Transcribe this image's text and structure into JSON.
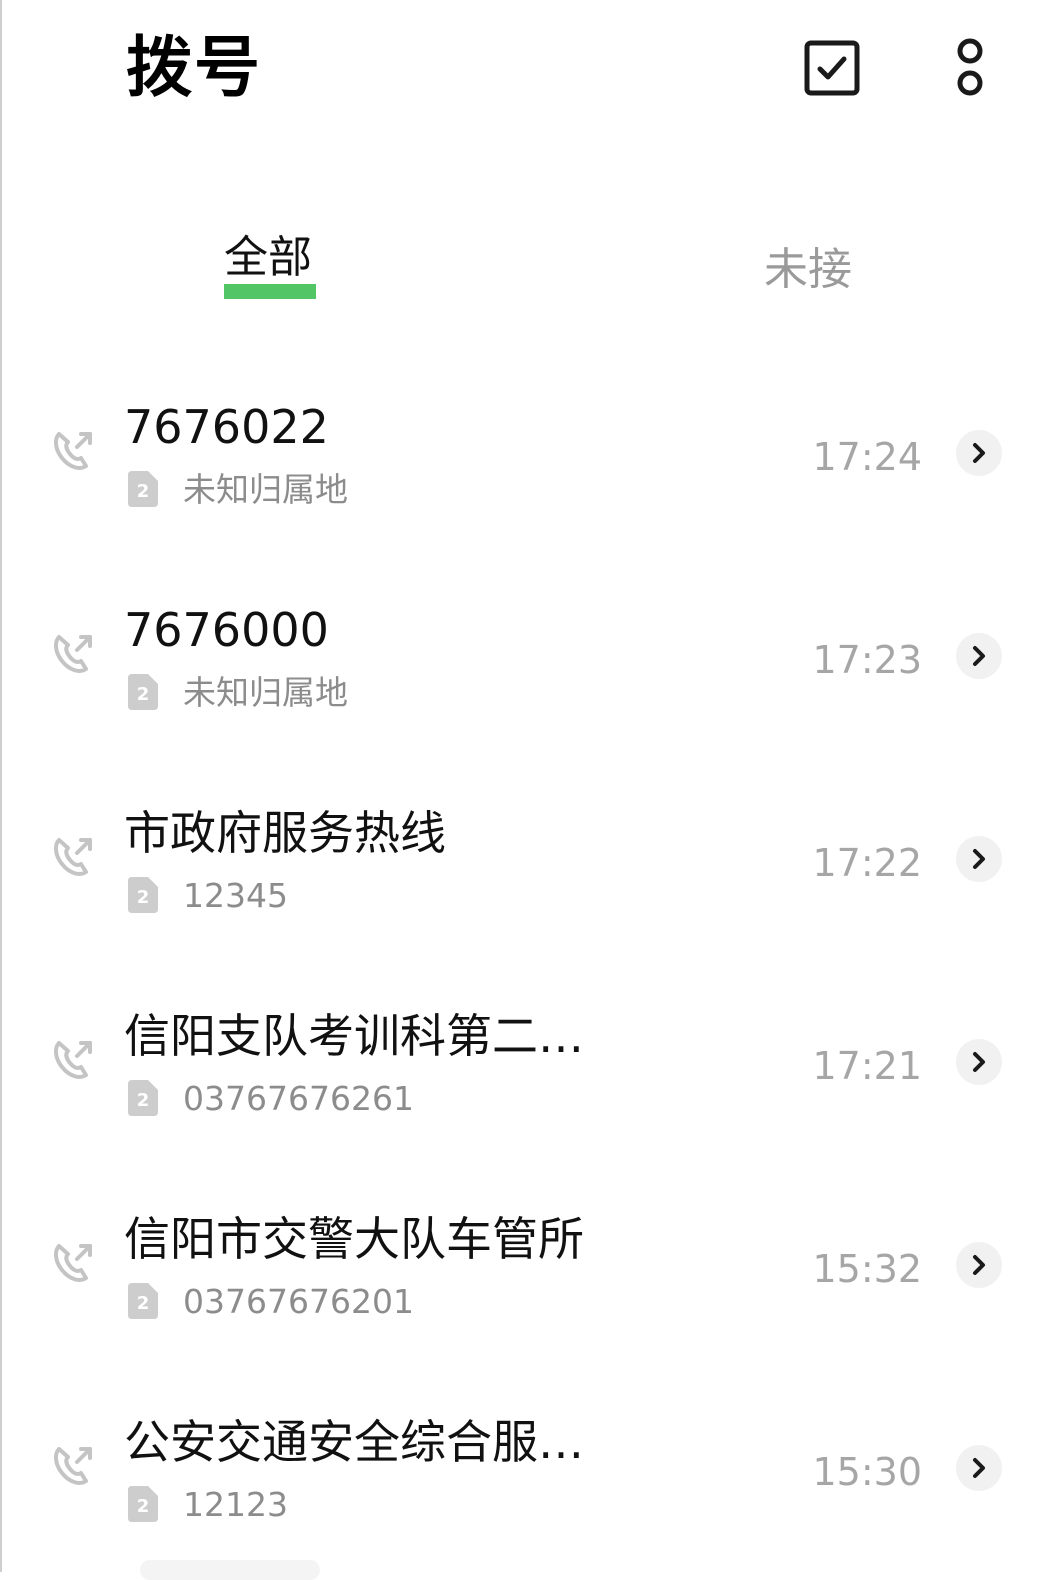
{
  "header": {
    "title": "拨号",
    "select_icon": "checkbox-icon",
    "more_icon": "more-options-icon"
  },
  "tabs": [
    {
      "label": "全部",
      "active": true
    },
    {
      "label": "未接",
      "active": false
    }
  ],
  "colors": {
    "accent": "#52c567",
    "secondary_text": "#8c8c8c",
    "time_text": "#a6a6a6"
  },
  "calls": [
    {
      "name": "7676022",
      "sub": "未知归属地",
      "time": "17:24",
      "sim": "2"
    },
    {
      "name": "7676000",
      "sub": "未知归属地",
      "time": "17:23",
      "sim": "2"
    },
    {
      "name": "市政府服务热线",
      "sub": "12345",
      "time": "17:22",
      "sim": "2"
    },
    {
      "name": "信阳支队考训科第二…",
      "sub": "03767676261",
      "time": "17:21",
      "sim": "2"
    },
    {
      "name": "信阳市交警大队车管所",
      "sub": "03767676201",
      "time": "15:32",
      "sim": "2"
    },
    {
      "name": "公安交通安全综合服…",
      "sub": "12123",
      "time": "15:30",
      "sim": "2"
    }
  ]
}
